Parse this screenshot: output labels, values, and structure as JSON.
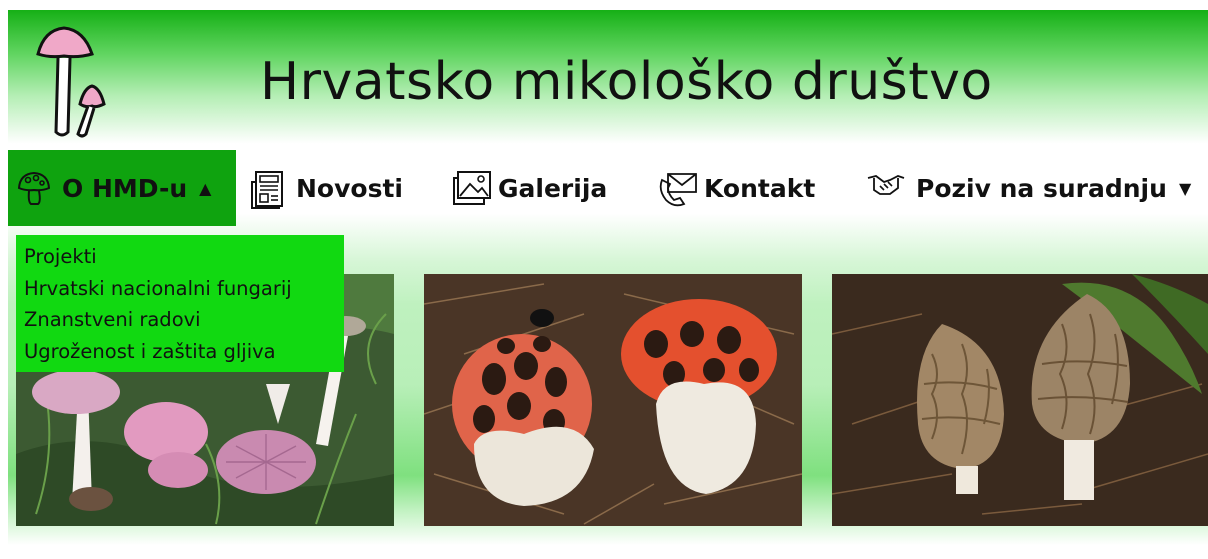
{
  "site": {
    "title": "Hrvatsko mikološko društvo"
  },
  "nav": {
    "items": [
      {
        "label": "O HMD-u",
        "icon": "mushroom-icon",
        "caret": "▲"
      },
      {
        "label": "Novosti",
        "icon": "newspaper-icon"
      },
      {
        "label": "Galerija",
        "icon": "gallery-icon"
      },
      {
        "label": "Kontakt",
        "icon": "contact-icon"
      },
      {
        "label": "Poziv na suradnju",
        "icon": "handshake-icon",
        "caret": "▼"
      }
    ]
  },
  "dropdown": {
    "items": [
      "Projekti",
      "Hrvatski nacionalni fungarij",
      "Znanstveni radovi",
      "Ugroženost i zaštita gljiva"
    ]
  },
  "photos": [
    {
      "subject": "pink mushrooms"
    },
    {
      "subject": "red cage fungus"
    },
    {
      "subject": "morels"
    }
  ],
  "colors": {
    "header_green": "#16b016",
    "nav_active": "#0fa30f",
    "dropdown_bg": "#11d911",
    "logo_pink": "#f0a8c8"
  }
}
